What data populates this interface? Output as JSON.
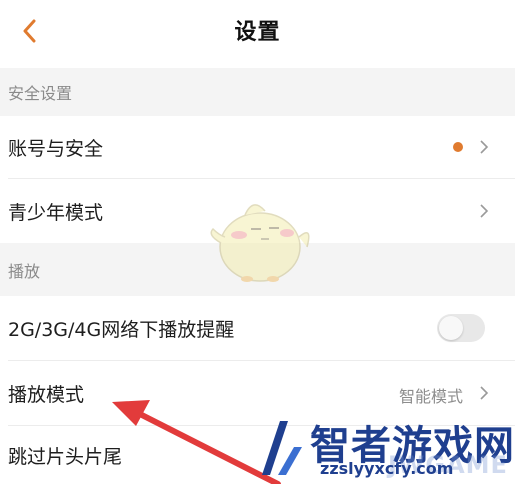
{
  "nav": {
    "title": "设置",
    "back_icon": "chevron-left-icon"
  },
  "sections": {
    "security": "安全设置",
    "playback": "播放"
  },
  "rows": {
    "account": {
      "label": "账号与安全",
      "has_dot": true
    },
    "teen_mode": {
      "label": "青少年模式"
    },
    "network_reminder": {
      "label": "2G/3G/4G网络下播放提醒",
      "toggle_on": false
    },
    "play_mode": {
      "label": "播放模式",
      "value": "智能模式"
    },
    "skip_intro": {
      "label": "跳过片头片尾"
    }
  },
  "colors": {
    "accent": "#e07b2f",
    "arrow": "#e23b3b",
    "watermark": "#1f3f8f"
  },
  "watermark": {
    "name": "智者游戏网",
    "url": "zzslyyxcfy.com",
    "ghost": "JWGAME"
  }
}
